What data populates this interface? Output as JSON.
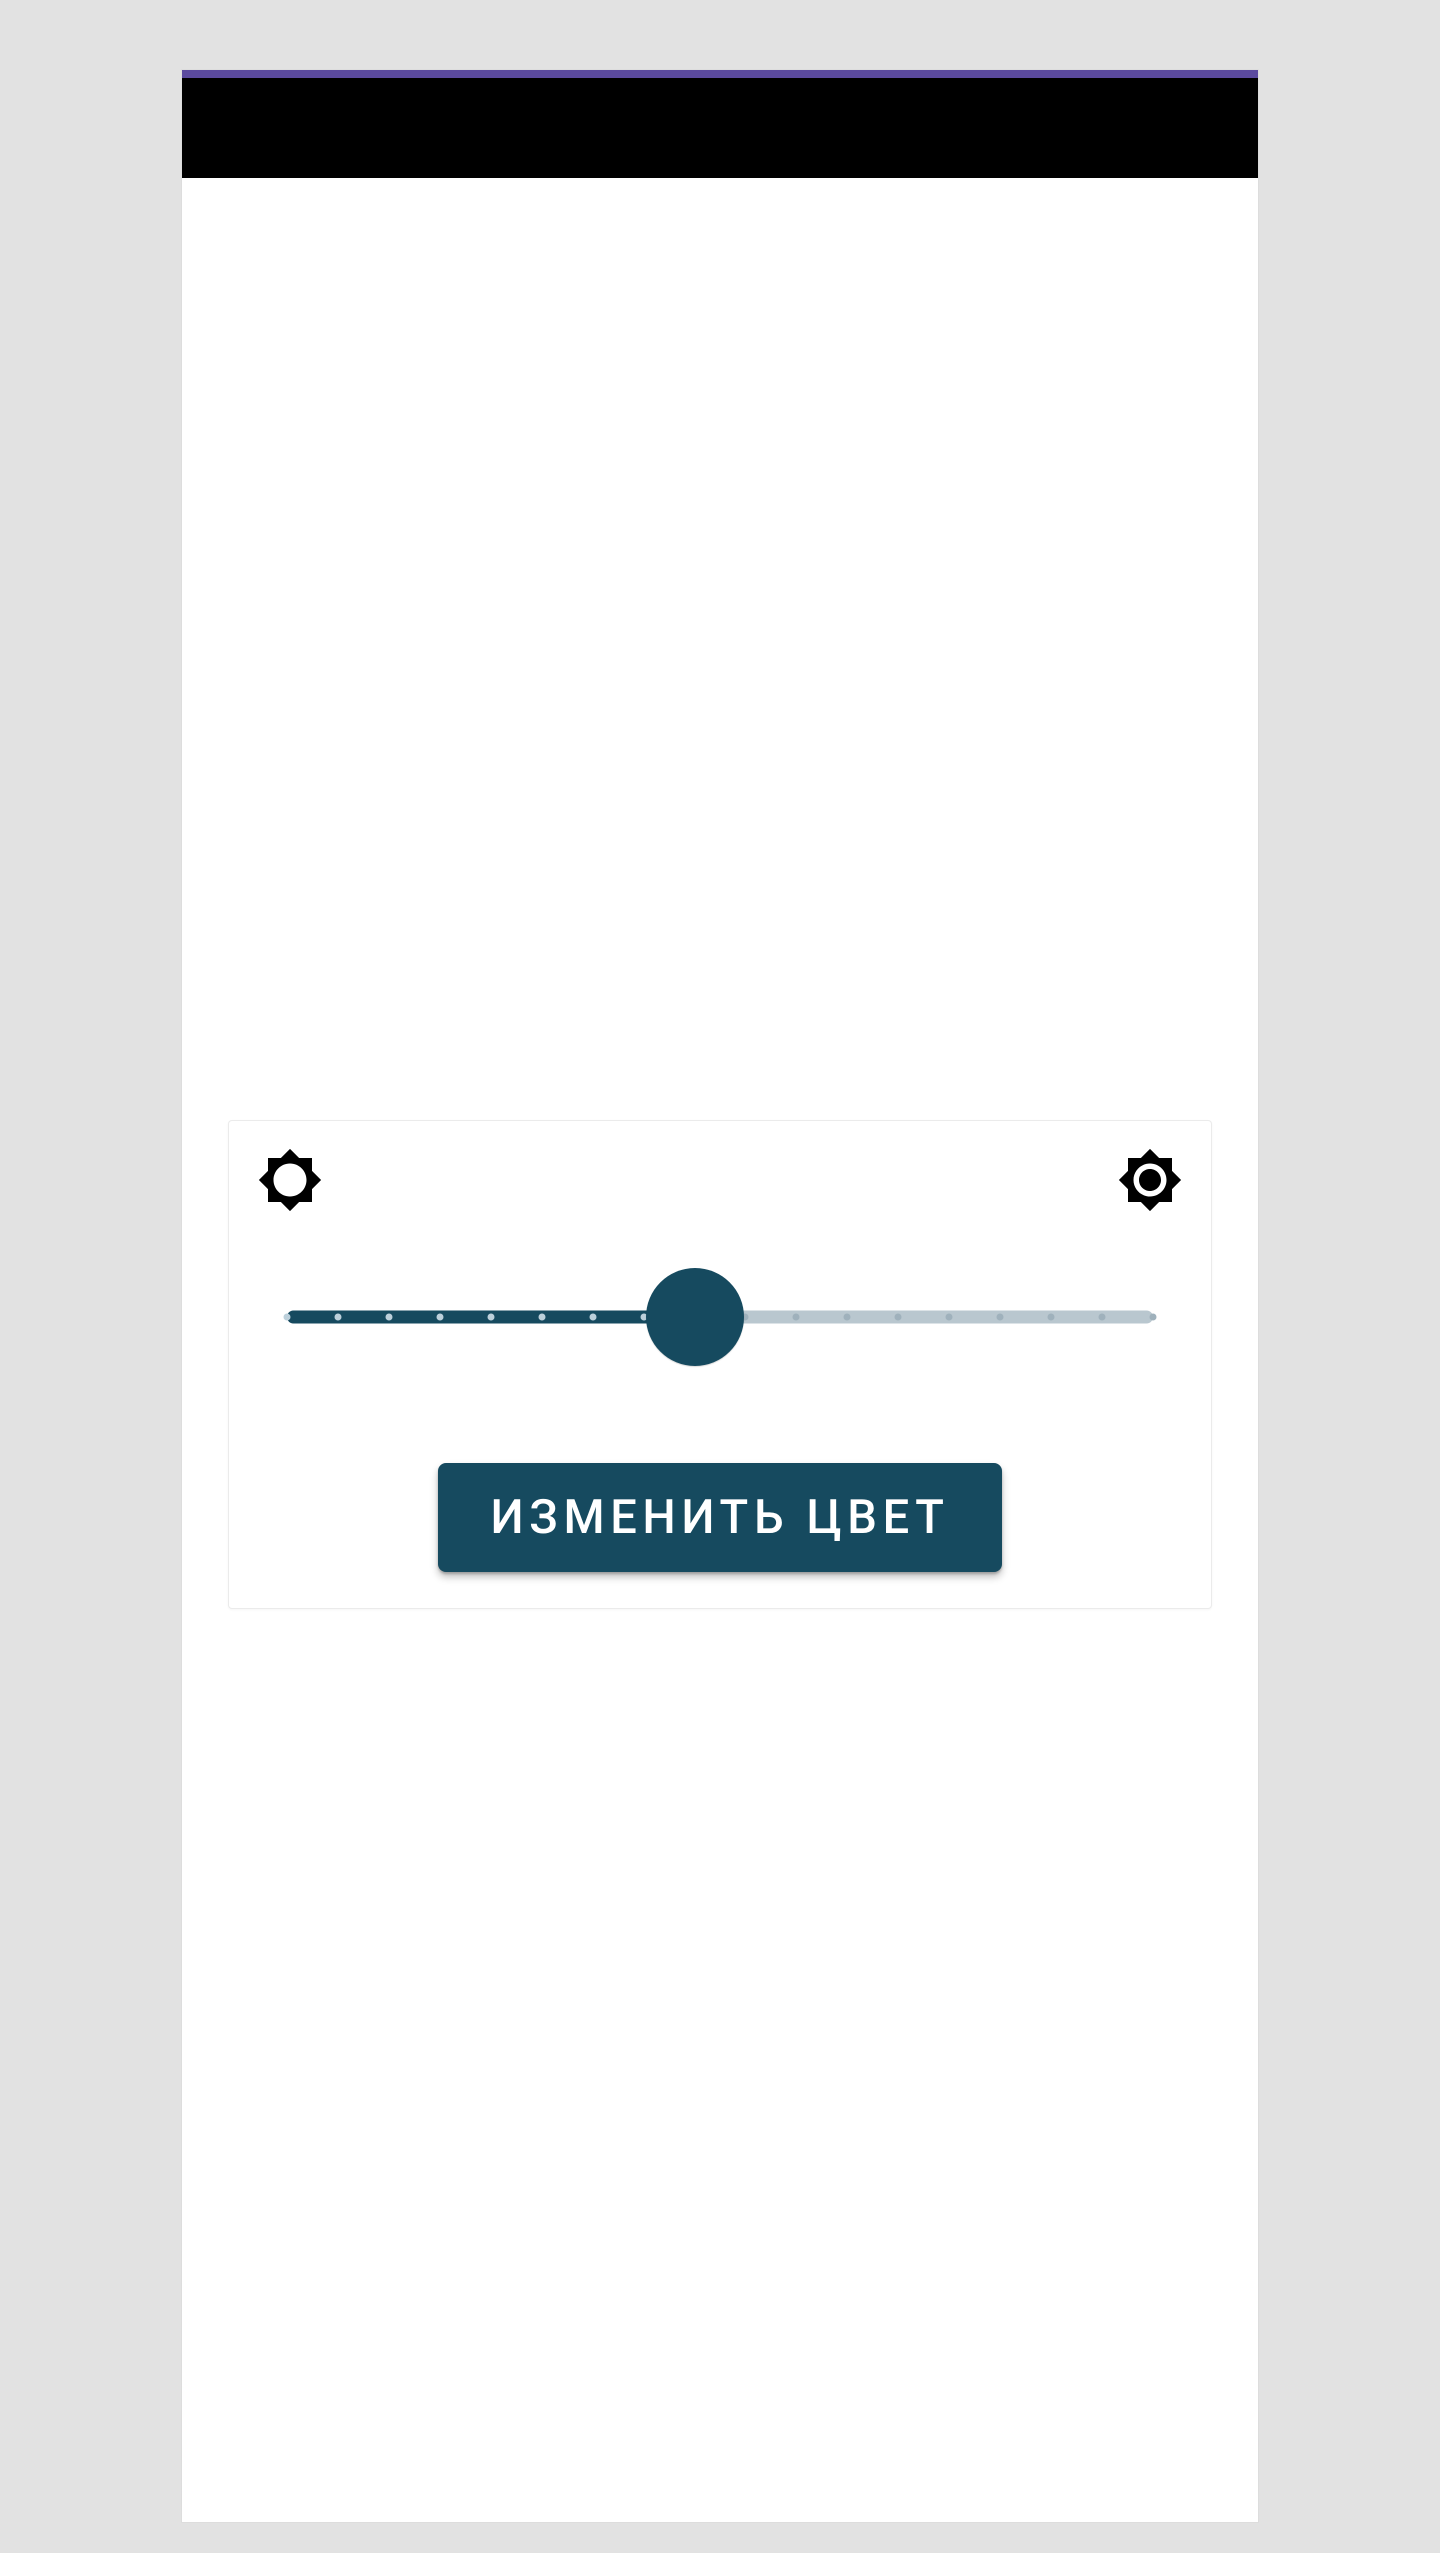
{
  "colors": {
    "accent": "#164a5f",
    "slider_inactive": "#b9c7cf",
    "status_strip": "#5b4a9e",
    "app_bar": "#000000",
    "page_bg": "#e2e2e2",
    "surface": "#ffffff"
  },
  "icons": {
    "left": "brightness-low-icon",
    "right": "brightness-high-icon"
  },
  "slider": {
    "min": 0,
    "max": 17,
    "value": 8,
    "ticks": 18
  },
  "button": {
    "change_color_label": "ИЗМЕНИТЬ ЦВЕТ"
  }
}
